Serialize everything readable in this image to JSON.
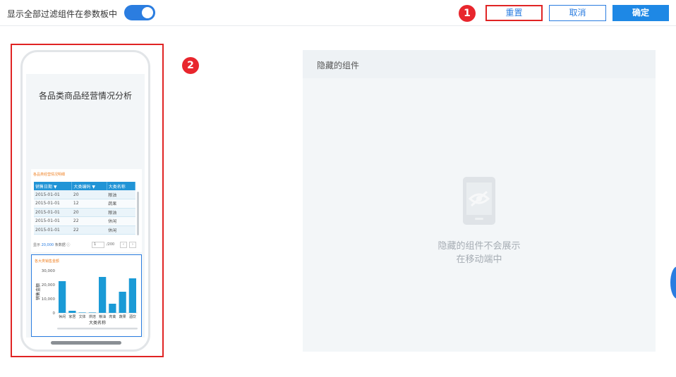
{
  "toolbar": {
    "toggle_label": "显示全部过滤组件在参数板中",
    "toggle_on": true,
    "reset_label": "重置",
    "cancel_label": "取消",
    "ok_label": "确定"
  },
  "markers": {
    "m1": "1",
    "m2": "2"
  },
  "phone": {
    "report_title": "各品类商品经营情况分析",
    "table_card": {
      "title": "各品类经营情况明细",
      "columns": [
        "销售日期",
        "大类编码",
        "大类名称"
      ],
      "rows": [
        [
          "2015-01-01",
          "20",
          "粮油"
        ],
        [
          "2015-01-01",
          "12",
          "蔬果"
        ],
        [
          "2015-01-01",
          "20",
          "粮油"
        ],
        [
          "2015-01-01",
          "22",
          "休闲"
        ],
        [
          "2015-01-01",
          "22",
          "休闲"
        ]
      ],
      "pager": {
        "show_prefix": "显示",
        "count": "20,000",
        "suffix": "条数据",
        "info_icon": "info-icon",
        "page": "1",
        "total_pages": "/200",
        "prev": "‹",
        "next": "›"
      }
    },
    "chart_card": {
      "title": "各大类销售金额"
    }
  },
  "chart_data": {
    "type": "bar",
    "title": "各大类销售金额",
    "xlabel": "大类名称",
    "ylabel": "销售金额",
    "categories": [
      "休闲",
      "家居",
      "文体",
      "烘焙",
      "粮油",
      "肉禽",
      "蔬果",
      "酒饮"
    ],
    "values": [
      22500,
      1500,
      300,
      300,
      25500,
      6500,
      15000,
      24500
    ],
    "yticks": [
      "30,000",
      "20,000",
      "10,000",
      "0"
    ],
    "ylim": [
      0,
      30000
    ],
    "bar_color": "#1a9ad6"
  },
  "hidden_panel": {
    "title": "隐藏的组件",
    "icon": "hidden-phone-icon",
    "empty_line1": "隐藏的组件不会展示",
    "empty_line2": "在移动端中"
  },
  "colors": {
    "accent": "#2b7de0",
    "marker": "#e8262d",
    "header_blue": "#2194d6"
  }
}
